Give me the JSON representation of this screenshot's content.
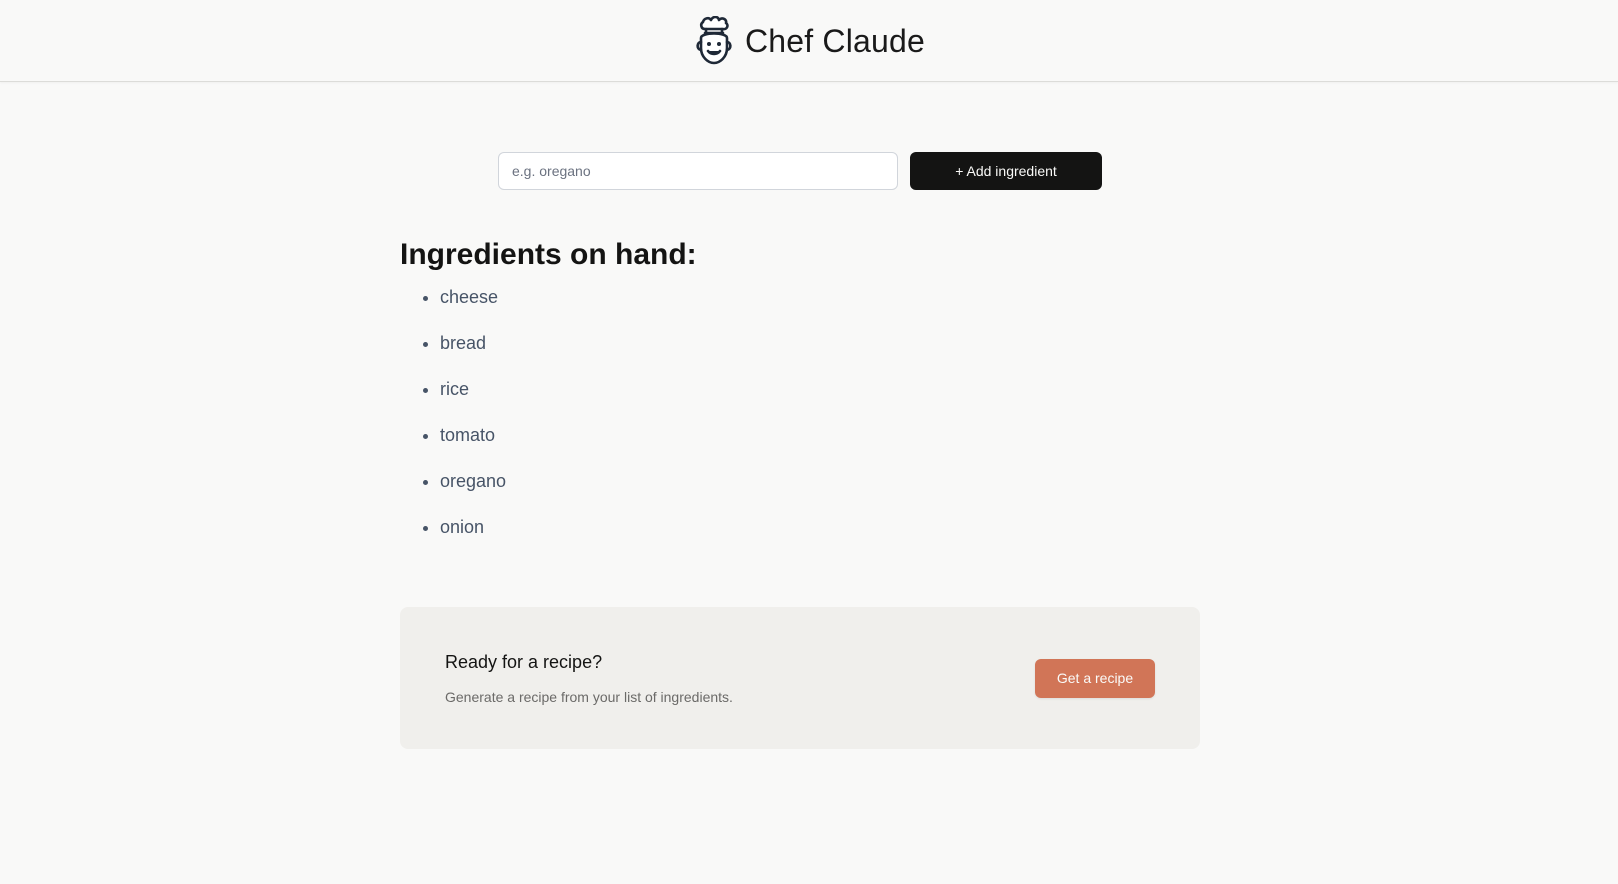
{
  "header": {
    "title": "Chef Claude",
    "logo_icon": "chef-face-icon"
  },
  "add_form": {
    "placeholder": "e.g. oregano",
    "value": "",
    "add_label": "+ Add ingredient"
  },
  "ingredients": {
    "heading": "Ingredients on hand:",
    "items": [
      "cheese",
      "bread",
      "rice",
      "tomato",
      "oregano",
      "onion"
    ]
  },
  "recipe_card": {
    "heading": "Ready for a recipe?",
    "text": "Generate a recipe from your list of ingredients.",
    "button_label": "Get a recipe"
  },
  "colors": {
    "background": "#f9f9f8",
    "primary_button": "#141413",
    "accent_button": "#d17557",
    "card_background": "#f0efec",
    "list_text": "#475467"
  }
}
